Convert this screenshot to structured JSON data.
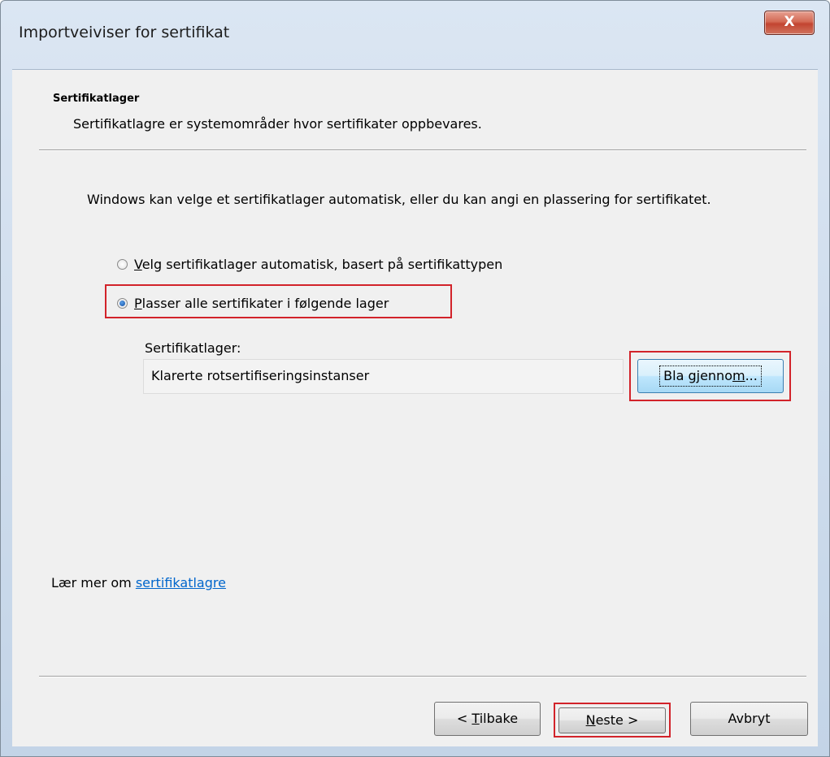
{
  "window": {
    "title": "Importveiviser for sertifikat",
    "close_label": "X"
  },
  "header": {
    "title": "Sertifikatlager",
    "description": "Sertifikatlagre er systemområder hvor sertifikater oppbevares."
  },
  "body": {
    "intro": "Windows kan velge et sertifikatlager automatisk, eller du kan angi en plassering for sertifikatet.",
    "option_auto": {
      "accel": "V",
      "rest": "elg sertifikatlager automatisk, basert på sertifikattypen",
      "selected": false
    },
    "option_manual": {
      "accel": "P",
      "rest": "lasser alle sertifikater i følgende lager",
      "selected": true
    },
    "store_label": "Sertifikatlager:",
    "store_value": "Klarerte rotsertifiseringsinstanser",
    "browse": {
      "before": "Bla gjenno",
      "accel": "m",
      "after": "..."
    }
  },
  "footer": {
    "learn_prefix": "Lær mer om ",
    "learn_link": "sertifikatlagre",
    "back": {
      "before": "< ",
      "accel": "T",
      "after": "ilbake"
    },
    "next": {
      "accel": "N",
      "after": "este >"
    },
    "cancel": "Avbryt"
  },
  "colors": {
    "highlight": "#d2232a",
    "link": "#0066cc",
    "dialog_bg": "#f0f0f0"
  }
}
